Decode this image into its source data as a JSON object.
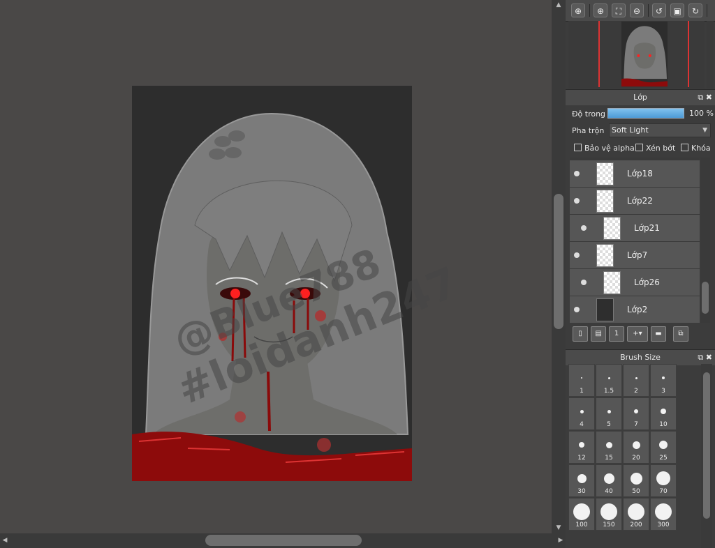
{
  "canvas": {
    "watermark_line1": "@Blue788",
    "watermark_line2": "#loidanh247"
  },
  "toolbar": {
    "buttons": [
      {
        "name": "zoom-in-icon",
        "glyph": "⊕"
      },
      {
        "name": "zoom-icon",
        "glyph": "⊕"
      },
      {
        "name": "fit-icon",
        "glyph": "⛶"
      },
      {
        "name": "zoom-out-icon",
        "glyph": "⊖"
      },
      {
        "name": "rotate-left-icon",
        "glyph": "↺"
      },
      {
        "name": "reset-view-icon",
        "glyph": "▣"
      },
      {
        "name": "rotate-right-icon",
        "glyph": "↻"
      }
    ]
  },
  "layers_panel": {
    "title": "Lớp",
    "opacity_label": "Độ trong",
    "opacity_value": "100 %",
    "opacity_fraction": 1.0,
    "blend_label": "Pha trộn",
    "blend_value": "Soft Light",
    "protect_alpha": "Bảo vệ alpha",
    "clipping": "Xén bớt",
    "lock": "Khóa",
    "layers": [
      {
        "name": "Lớp18",
        "clipped": false
      },
      {
        "name": "Lớp22",
        "clipped": false
      },
      {
        "name": "Lớp21",
        "clipped": true
      },
      {
        "name": "Lớp7",
        "clipped": false
      },
      {
        "name": "Lớp26",
        "clipped": true
      },
      {
        "name": "Lớp2",
        "clipped": false
      }
    ]
  },
  "brush_panel": {
    "title": "Brush Size",
    "sizes": [
      "1",
      "1.5",
      "2",
      "3",
      "4",
      "5",
      "7",
      "10",
      "12",
      "15",
      "20",
      "25",
      "30",
      "40",
      "50",
      "70",
      "100",
      "150",
      "200",
      "300"
    ]
  },
  "colors": {
    "canvas_bg": "#4a4847",
    "accent_blue": "#5fa9e2",
    "navigator_frame": "#dd3333"
  }
}
